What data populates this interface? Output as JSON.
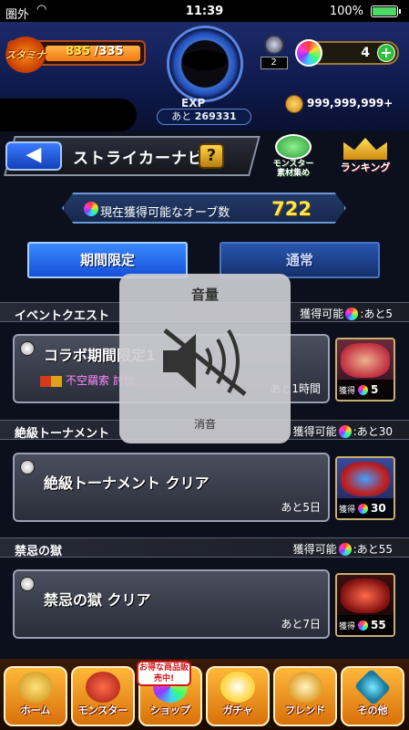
{
  "status_bar": {
    "carrier": "圏外",
    "time": "11:39",
    "battery_pct": "100%",
    "wifi_icon": "wifi-icon",
    "battery_icon": "battery-icon"
  },
  "header": {
    "stamina_label": "スタミナ",
    "stamina_current": "835",
    "stamina_max": "/335",
    "exp_label": "EXP",
    "exp_remaining_prefix": "あと",
    "exp_remaining": "269331",
    "luck_stones": "2",
    "orbs": "4",
    "orb_plus": "+",
    "gold": "999,999,999+"
  },
  "titlebar": {
    "back_icon": "◀",
    "title": "ストライカーナビ",
    "help_label": "?",
    "monster_menu_label_1": "モンスター",
    "monster_menu_label_2": "素材集め",
    "ranking_label": "ランキング"
  },
  "orb_summary": {
    "label": "現在獲得可能なオーブ数",
    "value": "722"
  },
  "tabs": {
    "limited": "期間限定",
    "normal": "通常"
  },
  "sections": [
    {
      "name": "イベントクエスト",
      "reward_prefix": "獲得可能",
      "reward_suffix": ":あと5",
      "quest": {
        "title": "コラボ期間限定1",
        "subtitle": "不空羂索 討伐",
        "remaining": "あと1時間",
        "obtain_label": "獲得",
        "obtain_count": "5"
      }
    },
    {
      "name": "絶級トーナメント",
      "reward_prefix": "獲得可能",
      "reward_suffix": ":あと30",
      "quest": {
        "title": "絶級トーナメント クリア",
        "remaining": "あと5日",
        "obtain_label": "獲得",
        "obtain_count": "30"
      }
    },
    {
      "name": "禁忌の獄",
      "reward_prefix": "獲得可能",
      "reward_suffix": ":あと55",
      "quest": {
        "title": "禁忌の獄 クリア",
        "remaining": "あと7日",
        "obtain_label": "獲得",
        "obtain_count": "55"
      }
    }
  ],
  "volume_hud": {
    "title": "音量",
    "label": "消音",
    "icon": "speaker-muted-icon"
  },
  "bottom_nav": {
    "items": [
      "ホーム",
      "モンスター",
      "ショップ",
      "ガチャ",
      "フレンド",
      "その他"
    ],
    "shop_badge": "お得な商品販売中!"
  },
  "colors": {
    "accent_blue": "#1550d8",
    "orb_value": "#ffe44a",
    "nav_orange": "#d8700a"
  }
}
